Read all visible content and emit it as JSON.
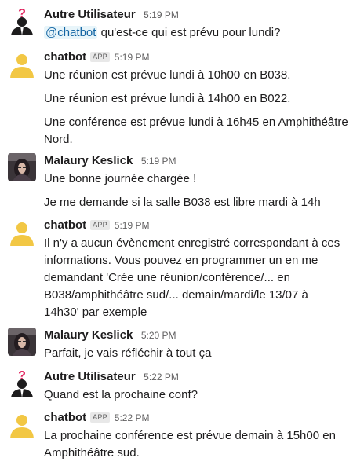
{
  "messages": [
    {
      "author": "Autre Utilisateur",
      "avatar": "user-question-icon",
      "time": "5:19 PM",
      "is_app": false,
      "mention": "@chatbot",
      "text": " qu'est-ce qui est prévu pour lundi?"
    },
    {
      "author": "chatbot",
      "avatar": "bot-default-avatar",
      "app_badge": "APP",
      "time": "5:19 PM",
      "lines": [
        "Une réunion est prévue lundi à 10h00 en B038.",
        "Une réunion est prévue lundi à 14h00 en B022.",
        "Une conférence est prévue lundi à 16h45 en Amphithéâtre",
        "Nord."
      ]
    },
    {
      "author": "Malaury Keslick",
      "avatar": "photo-avatar",
      "time": "5:19 PM",
      "lines": [
        "Une bonne journée chargée !",
        "Je me demande si la salle B038 est libre mardi à 14h"
      ]
    },
    {
      "author": "chatbot",
      "avatar": "bot-default-avatar",
      "app_badge": "APP",
      "time": "5:19 PM",
      "lines": [
        "Il n'y a aucun évènement enregistré correspondant à ces",
        "informations. Vous pouvez en programmer un en me",
        "demandant 'Crée une réunion/conférence/... en",
        "B038/amphithéâtre sud/... demain/mardi/le 13/07 à",
        "14h30' par exemple"
      ]
    },
    {
      "author": "Malaury Keslick",
      "avatar": "photo-avatar",
      "time": "5:20 PM",
      "lines": [
        "Parfait, je vais réfléchir à tout ça"
      ]
    },
    {
      "author": "Autre Utilisateur",
      "avatar": "user-question-icon",
      "time": "5:22 PM",
      "lines": [
        "Quand est la prochaine conf?"
      ]
    },
    {
      "author": "chatbot",
      "avatar": "bot-default-avatar",
      "app_badge": "APP",
      "time": "5:22 PM",
      "lines": [
        "La prochaine conférence est prévue demain à 15h00 en",
        "Amphithéâtre sud."
      ]
    }
  ],
  "colors": {
    "text": "#1d1c1d",
    "muted": "#616061",
    "mention_bg": "#e8f5fa",
    "mention_fg": "#1264a3",
    "bot_avatar": "#f2c744",
    "question_mark": "#e01e5a"
  }
}
